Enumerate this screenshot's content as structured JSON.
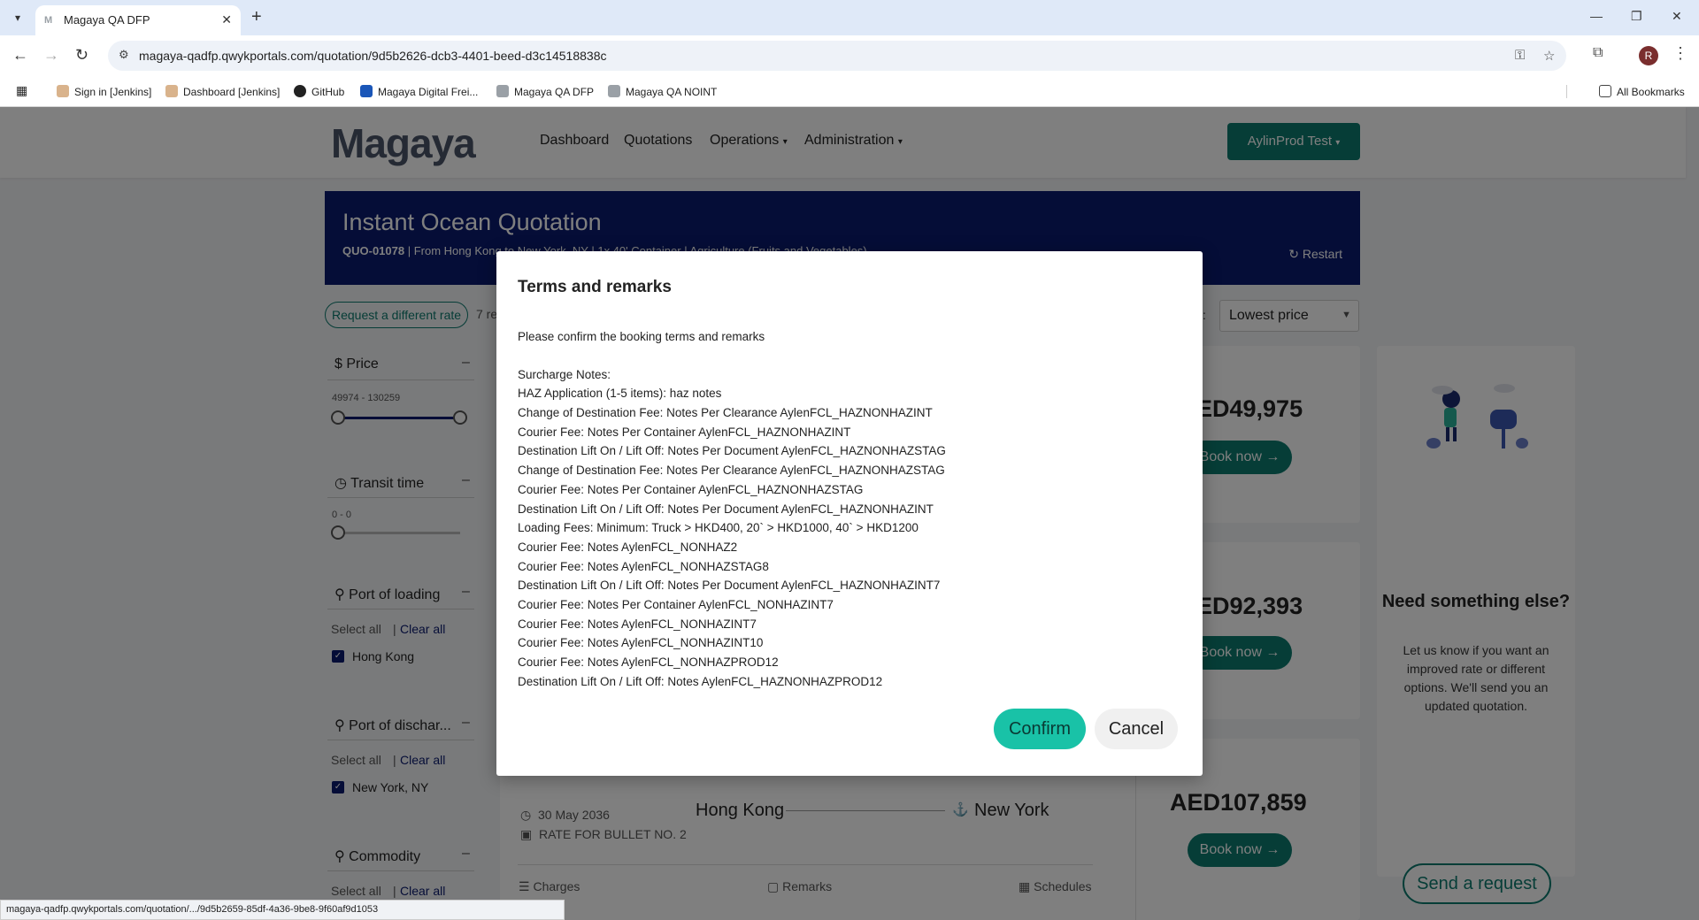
{
  "browser": {
    "tab_title": "Magaya QA DFP",
    "tab_favicon": "M",
    "new_tab_symbol": "+",
    "url": "magaya-qadfp.qwykportals.com/quotation/9d5b2626-dcb3-4401-beed-d3c14518838c",
    "profile_initial": "R",
    "bookmarks": [
      {
        "label": "Sign in [Jenkins]",
        "icon": "jenkins-icon"
      },
      {
        "label": "Dashboard [Jenkins]",
        "icon": "jenkins-icon"
      },
      {
        "label": "GitHub",
        "icon": "github-icon"
      },
      {
        "label": "Magaya Digital Frei...",
        "icon": "magaya-icon"
      },
      {
        "label": "Magaya QA DFP",
        "icon": "magaya-icon"
      },
      {
        "label": "Magaya QA NOINT",
        "icon": "magaya-icon"
      }
    ],
    "all_bookmarks": "All Bookmarks",
    "status_url": "magaya-qadfp.qwykportals.com/quotation/.../9d5b2659-85df-4a36-9be8-9f60af9d1053"
  },
  "header": {
    "logo": "Magaya",
    "nav": [
      "Dashboard",
      "Quotations",
      "Operations",
      "Administration"
    ],
    "user": "AylinProd Test"
  },
  "hero": {
    "title": "Instant Ocean Quotation",
    "subtitle_id": "QUO-01078",
    "subtitle_rest": "| From Hong Kong to New York, NY | 1x 40' Container | Agriculture (Fruits and Vegetables)",
    "restart": "Restart"
  },
  "results": {
    "request_different_rate": "Request a different rate",
    "count": "7 re",
    "sort_label": "y:",
    "sort_value": "Lowest price"
  },
  "filters": {
    "price_title": "Price",
    "price_range": "49974 - 130259",
    "transit_title": "Transit time",
    "transit_range": "0 - 0",
    "pol_title": "Port of loading",
    "pol_option": "Hong Kong",
    "pod_title": "Port of dischar...",
    "pod_option": "New York, NY",
    "commodity_title": "Commodity",
    "select_all": "Select all",
    "clear_all": "Clear all"
  },
  "cards": {
    "prices": [
      "ED49,975",
      "ED92,393",
      "AED107,859"
    ],
    "book_now": "Book now",
    "card3_date": "30 May 2036",
    "card3_rate": "RATE FOR BULLET NO. 2",
    "card3_origin": "Hong Kong",
    "card3_dest": "New York",
    "charges": "Charges",
    "remarks": "Remarks",
    "schedules": "Schedules"
  },
  "side": {
    "need_title": "Need something else?",
    "need_body": "Let us know if you want an improved rate or different options. We'll send you an updated quotation.",
    "send_request": "Send a request"
  },
  "modal": {
    "title": "Terms and remarks",
    "intro": "Please confirm the booking terms and remarks",
    "notes_header": "Surcharge Notes:",
    "lines": [
      "HAZ Application (1-5 items): haz notes",
      "Change of Destination Fee: Notes Per Clearance AylenFCL_HAZNONHAZINT",
      "Courier Fee: Notes Per Container AylenFCL_HAZNONHAZINT",
      "Destination Lift On / Lift Off: Notes Per Document AylenFCL_HAZNONHAZSTAG",
      "Change of Destination Fee: Notes Per Clearance AylenFCL_HAZNONHAZSTAG",
      "Courier Fee: Notes Per Container AylenFCL_HAZNONHAZSTAG",
      "Destination Lift On / Lift Off: Notes Per Document AylenFCL_HAZNONHAZINT",
      "Loading Fees: Minimum: Truck > HKD400, 20` > HKD1000, 40` > HKD1200",
      "Courier Fee: Notes AylenFCL_NONHAZ2",
      "Courier Fee: Notes AylenFCL_NONHAZSTAG8",
      "Destination Lift On / Lift Off: Notes Per Document AylenFCL_HAZNONHAZINT7",
      "Courier Fee: Notes Per Container AylenFCL_NONHAZINT7",
      "Courier Fee: Notes AylenFCL_NONHAZINT7",
      "Courier Fee: Notes AylenFCL_NONHAZINT10",
      "Courier Fee: Notes AylenFCL_NONHAZPROD12",
      "Destination Lift On / Lift Off: Notes AylenFCL_HAZNONHAZPROD12"
    ],
    "confirm": "Confirm",
    "cancel": "Cancel"
  },
  "colors": {
    "brand_green": "#0c7a6e",
    "confirm_green": "#19c2a7",
    "hero_navy": "#0a1a6e"
  }
}
